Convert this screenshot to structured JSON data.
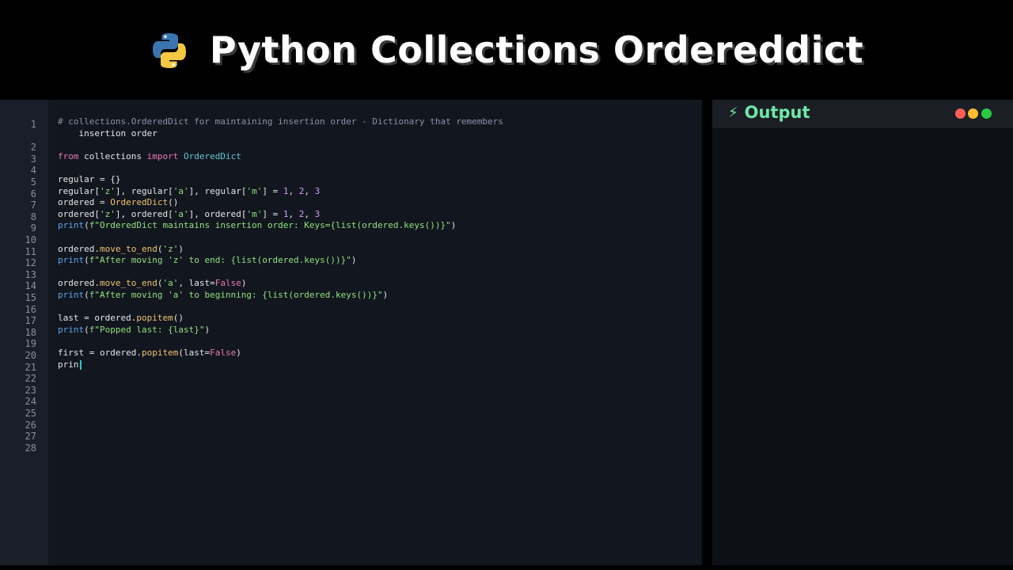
{
  "header": {
    "title": "Python Collections Ordereddict",
    "logo_icon": "python-logo-icon"
  },
  "editor": {
    "line_numbers": [
      "1",
      "2",
      "3",
      "4",
      "5",
      "6",
      "7",
      "8",
      "9",
      "10",
      "11",
      "12",
      "13",
      "14",
      "15",
      "16",
      "17",
      "18",
      "19",
      "20",
      "21",
      "22",
      "23",
      "24",
      "25",
      "26",
      "27",
      "28"
    ],
    "lines": [
      {
        "num": "1",
        "segments": [
          {
            "t": "# collections.OrderedDict for maintaining insertion order - Dictionary that remembers",
            "c": "comment"
          }
        ]
      },
      {
        "num": "",
        "segments": [
          {
            "t": "    insertion order",
            "c": "plain"
          }
        ]
      },
      {
        "num": "2",
        "segments": []
      },
      {
        "num": "3",
        "segments": [
          {
            "t": "from",
            "c": "kw"
          },
          {
            "t": " collections ",
            "c": "plain"
          },
          {
            "t": "import",
            "c": "kw"
          },
          {
            "t": " ",
            "c": "plain"
          },
          {
            "t": "OrderedDict",
            "c": "cls"
          }
        ]
      },
      {
        "num": "4",
        "segments": []
      },
      {
        "num": "5",
        "segments": [
          {
            "t": "regular = {}",
            "c": "plain"
          }
        ]
      },
      {
        "num": "6",
        "segments": [
          {
            "t": "regular[",
            "c": "plain"
          },
          {
            "t": "'z'",
            "c": "str"
          },
          {
            "t": "], regular[",
            "c": "plain"
          },
          {
            "t": "'a'",
            "c": "str"
          },
          {
            "t": "], regular[",
            "c": "plain"
          },
          {
            "t": "'m'",
            "c": "str"
          },
          {
            "t": "] = ",
            "c": "plain"
          },
          {
            "t": "1",
            "c": "num"
          },
          {
            "t": ", ",
            "c": "plain"
          },
          {
            "t": "2",
            "c": "num"
          },
          {
            "t": ", ",
            "c": "plain"
          },
          {
            "t": "3",
            "c": "num"
          }
        ]
      },
      {
        "num": "7",
        "segments": [
          {
            "t": "ordered = ",
            "c": "plain"
          },
          {
            "t": "OrderedDict",
            "c": "fn"
          },
          {
            "t": "()",
            "c": "plain"
          }
        ]
      },
      {
        "num": "8",
        "segments": [
          {
            "t": "ordered[",
            "c": "plain"
          },
          {
            "t": "'z'",
            "c": "str"
          },
          {
            "t": "], ordered[",
            "c": "plain"
          },
          {
            "t": "'a'",
            "c": "str"
          },
          {
            "t": "], ordered[",
            "c": "plain"
          },
          {
            "t": "'m'",
            "c": "str"
          },
          {
            "t": "] = ",
            "c": "plain"
          },
          {
            "t": "1",
            "c": "num"
          },
          {
            "t": ", ",
            "c": "plain"
          },
          {
            "t": "2",
            "c": "num"
          },
          {
            "t": ", ",
            "c": "plain"
          },
          {
            "t": "3",
            "c": "num"
          }
        ]
      },
      {
        "num": "9",
        "segments": [
          {
            "t": "print",
            "c": "print"
          },
          {
            "t": "(",
            "c": "plain"
          },
          {
            "t": "f\"OrderedDict maintains insertion order: Keys={list(ordered.keys())}\"",
            "c": "str"
          },
          {
            "t": ")",
            "c": "plain"
          }
        ]
      },
      {
        "num": "10",
        "segments": []
      },
      {
        "num": "11",
        "segments": [
          {
            "t": "ordered.",
            "c": "plain"
          },
          {
            "t": "move_to_end",
            "c": "fn"
          },
          {
            "t": "(",
            "c": "plain"
          },
          {
            "t": "'z'",
            "c": "str"
          },
          {
            "t": ")",
            "c": "plain"
          }
        ]
      },
      {
        "num": "12",
        "segments": [
          {
            "t": "print",
            "c": "print"
          },
          {
            "t": "(",
            "c": "plain"
          },
          {
            "t": "f\"After moving 'z' to end: {list(ordered.keys())}\"",
            "c": "str"
          },
          {
            "t": ")",
            "c": "plain"
          }
        ]
      },
      {
        "num": "13",
        "segments": []
      },
      {
        "num": "14",
        "segments": [
          {
            "t": "ordered.",
            "c": "plain"
          },
          {
            "t": "move_to_end",
            "c": "fn"
          },
          {
            "t": "(",
            "c": "plain"
          },
          {
            "t": "'a'",
            "c": "str"
          },
          {
            "t": ", last=",
            "c": "plain"
          },
          {
            "t": "False",
            "c": "kw"
          },
          {
            "t": ")",
            "c": "plain"
          }
        ]
      },
      {
        "num": "15",
        "segments": [
          {
            "t": "print",
            "c": "print"
          },
          {
            "t": "(",
            "c": "plain"
          },
          {
            "t": "f\"After moving 'a' to beginning: {list(ordered.keys())}\"",
            "c": "str"
          },
          {
            "t": ")",
            "c": "plain"
          }
        ]
      },
      {
        "num": "16",
        "segments": []
      },
      {
        "num": "17",
        "segments": [
          {
            "t": "last = ordered.",
            "c": "plain"
          },
          {
            "t": "popitem",
            "c": "fn"
          },
          {
            "t": "()",
            "c": "plain"
          }
        ]
      },
      {
        "num": "18",
        "segments": [
          {
            "t": "print",
            "c": "print"
          },
          {
            "t": "(",
            "c": "plain"
          },
          {
            "t": "f\"Popped last: {last}\"",
            "c": "str"
          },
          {
            "t": ")",
            "c": "plain"
          }
        ]
      },
      {
        "num": "19",
        "segments": []
      },
      {
        "num": "20",
        "segments": [
          {
            "t": "first = ordered.",
            "c": "plain"
          },
          {
            "t": "popitem",
            "c": "fn"
          },
          {
            "t": "(last=",
            "c": "plain"
          },
          {
            "t": "False",
            "c": "kw"
          },
          {
            "t": ")",
            "c": "plain"
          }
        ]
      },
      {
        "num": "21",
        "segments": [
          {
            "t": "prin",
            "c": "plain"
          }
        ]
      },
      {
        "num": "22",
        "segments": []
      },
      {
        "num": "23",
        "segments": []
      },
      {
        "num": "24",
        "segments": []
      },
      {
        "num": "25",
        "segments": []
      },
      {
        "num": "26",
        "segments": []
      },
      {
        "num": "27",
        "segments": []
      },
      {
        "num": "28",
        "segments": []
      }
    ]
  },
  "output": {
    "title": "Output",
    "title_icon": "lightning-bolt-icon",
    "bolt": "⚡",
    "window_dots": [
      {
        "name": "close-dot",
        "color": "#ff5f57"
      },
      {
        "name": "minimize-dot",
        "color": "#febc2e"
      },
      {
        "name": "maximize-dot",
        "color": "#28c840"
      }
    ]
  },
  "colors": {
    "comment": "#8b93a6",
    "keyword": "#e879b0",
    "class": "#5ec8d8",
    "function": "#f0c36a",
    "string": "#8fe37c",
    "number": "#d49cf5",
    "print": "#5aa6e8",
    "output_title": "#6ee7a7"
  }
}
